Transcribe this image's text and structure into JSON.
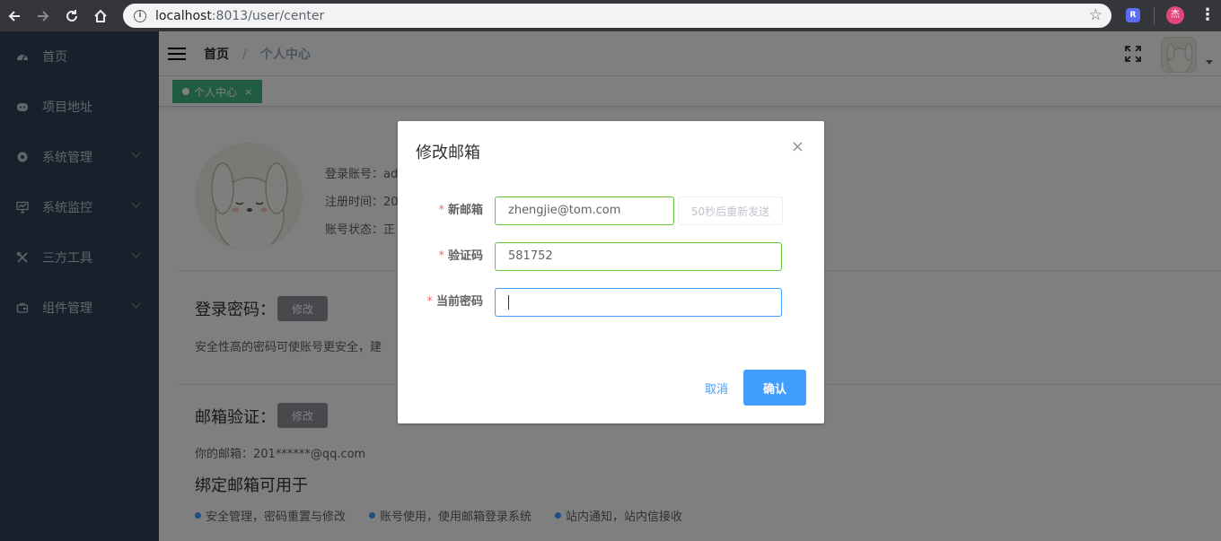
{
  "browser": {
    "url_host": "localhost",
    "url_port_path": ":8013/user/center",
    "extension_label": "R",
    "profile_initial": "杰"
  },
  "sidebar": {
    "items": [
      {
        "label": "首页",
        "icon": "dashboard-icon",
        "has_arrow": false
      },
      {
        "label": "项目地址",
        "icon": "github-icon",
        "has_arrow": false
      },
      {
        "label": "系统管理",
        "icon": "system-gear-icon",
        "has_arrow": true
      },
      {
        "label": "系统监控",
        "icon": "monitor-icon",
        "has_arrow": true
      },
      {
        "label": "三方工具",
        "icon": "tools-icon",
        "has_arrow": true
      },
      {
        "label": "组件管理",
        "icon": "component-icon",
        "has_arrow": true
      }
    ]
  },
  "navbar": {
    "breadcrumb_home": "首页",
    "breadcrumb_separator": "/",
    "breadcrumb_current": "个人中心"
  },
  "tags": {
    "active_tag": "个人中心",
    "close_glyph": "×"
  },
  "profile": {
    "login_account": "登录账号：ad",
    "register_time": "注册时间：20",
    "account_status": "账号状态：正",
    "password_title": "登录密码：",
    "password_btn": "修改",
    "password_desc": "安全性高的密码可使账号更安全，建",
    "email_title": "邮箱验证：",
    "email_btn": "修改",
    "email_current": "你的邮箱：201******@qq.com",
    "email_uses_title": "绑定邮箱可用于",
    "email_uses": [
      "安全管理，密码重置与修改",
      "账号使用，使用邮箱登录系统",
      "站内通知，站内信接收"
    ]
  },
  "dialog": {
    "title": "修改邮箱",
    "close_glyph": "×",
    "fields": {
      "new_email_label": "新邮箱",
      "new_email_value": "zhengjie@tom.com",
      "resend_label": "50秒后重新发送",
      "code_label": "验证码",
      "code_value": "581752",
      "password_label": "当前密码",
      "password_value": ""
    },
    "required_mark": "*",
    "cancel_label": "取消",
    "confirm_label": "确认"
  },
  "colors": {
    "sidebar_bg": "#304156",
    "primary": "#409eff",
    "success": "#67c23a",
    "tag_active": "#42b983",
    "danger": "#f56c6c"
  }
}
